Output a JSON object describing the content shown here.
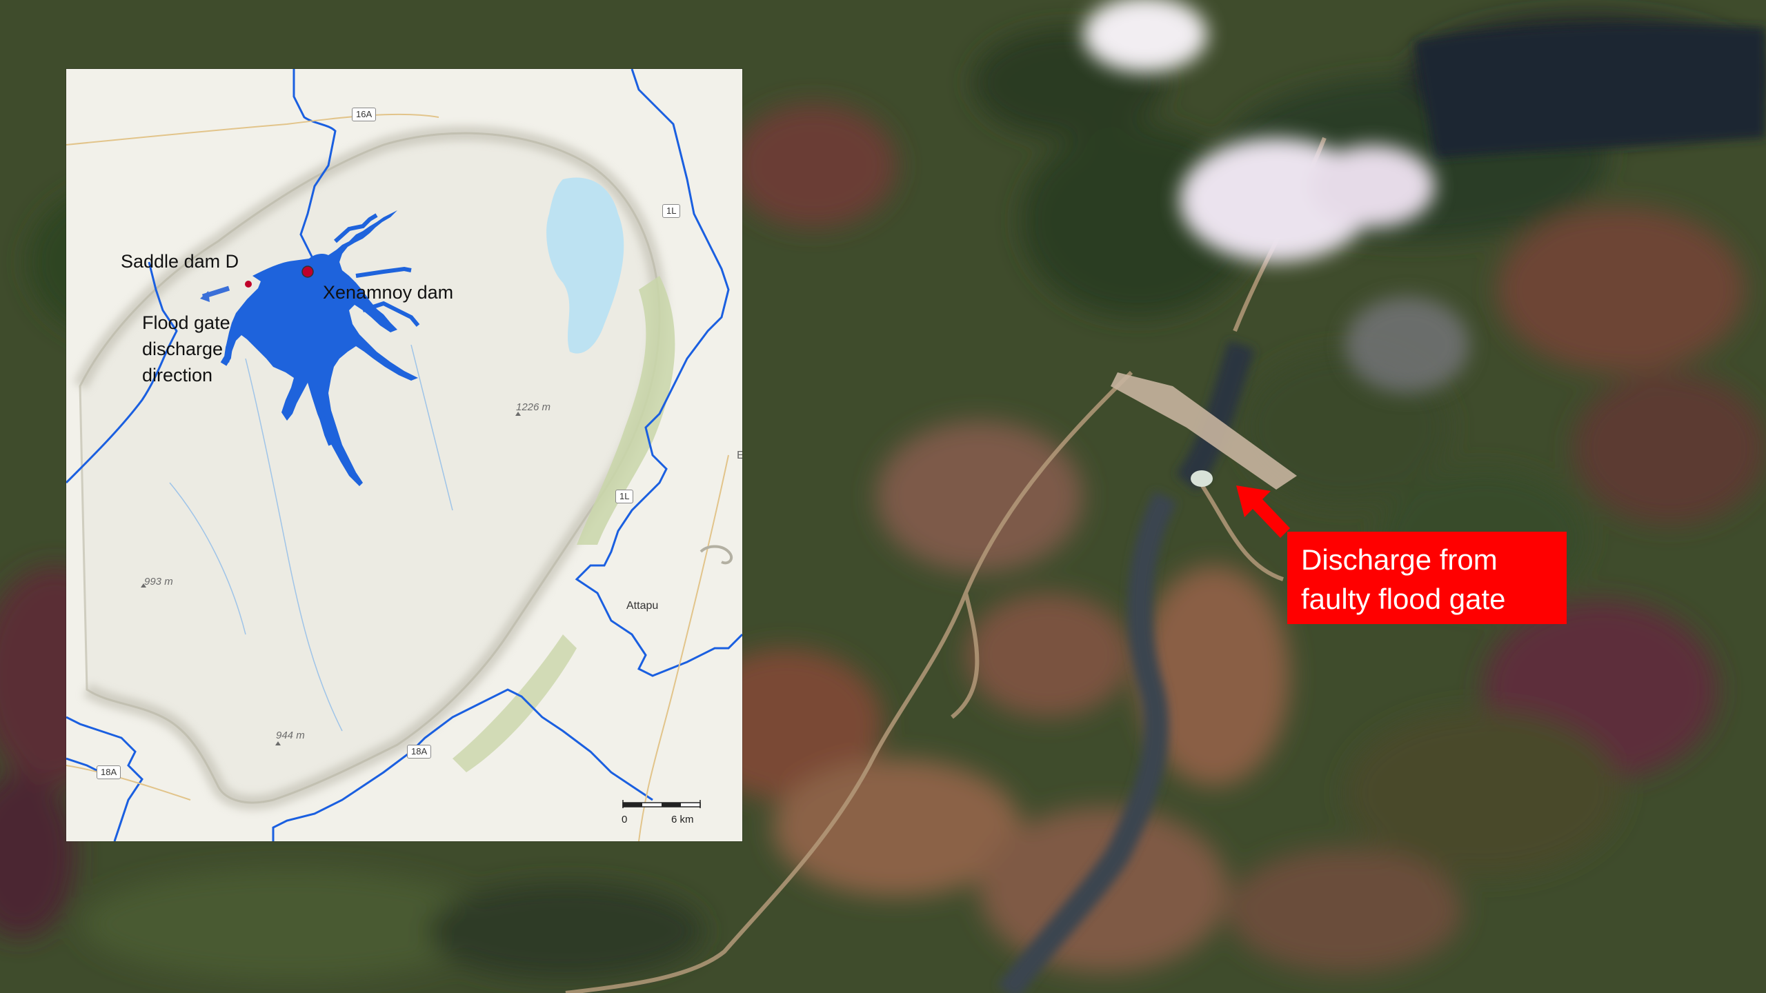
{
  "inset_map": {
    "labels": {
      "saddle_dam": "Saddle dam D",
      "dam": "Xenamnoy dam",
      "discharge_line1": "Flood gate",
      "discharge_line2": "discharge",
      "discharge_line3": "direction"
    },
    "elevations": [
      "1226 m",
      "993 m",
      "944 m"
    ],
    "road_shields": [
      "16A",
      "1L",
      "1L",
      "18A",
      "18A"
    ],
    "town": "Attapu",
    "edge_letter": "E",
    "scale": {
      "start": "0",
      "end": "6 km"
    },
    "colors": {
      "river": "#1a5fe0",
      "reservoir": "#1e63dc",
      "dam_marker": "#c0002a",
      "lake": "#bde2f2"
    }
  },
  "callout": {
    "line1": "Discharge from",
    "line2": "faulty flood gate",
    "color": "#ff0000"
  }
}
